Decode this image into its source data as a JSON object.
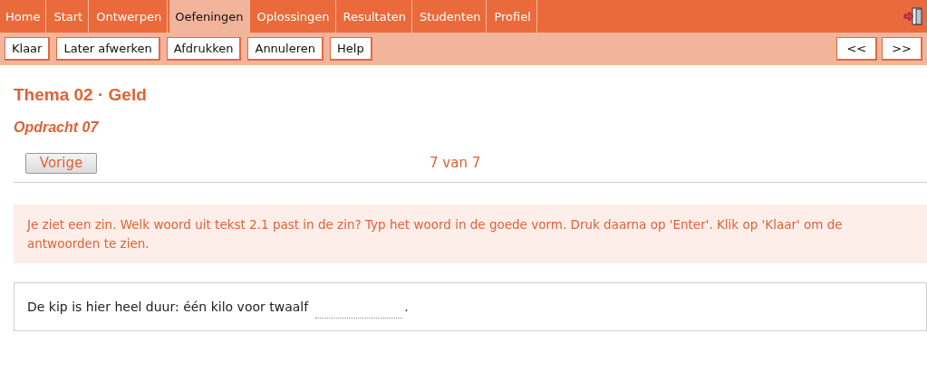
{
  "tabs": [
    {
      "label": "Home",
      "selected": false
    },
    {
      "label": "Start",
      "selected": false
    },
    {
      "label": "Ontwerpen",
      "selected": false
    },
    {
      "label": "Oefeningen",
      "selected": true
    },
    {
      "label": "Oplossingen",
      "selected": false
    },
    {
      "label": "Resultaten",
      "selected": false
    },
    {
      "label": "Studenten",
      "selected": false
    },
    {
      "label": "Profiel",
      "selected": false
    }
  ],
  "toolbar": [
    "Klaar",
    "Later afwerken",
    "Afdrukken",
    "Annuleren",
    "Help"
  ],
  "pager_buttons": [
    "<<",
    ">>"
  ],
  "title": "Thema 02 · Geld",
  "subtitle": "Opdracht 07",
  "previous_button": "Vorige",
  "position": "7 van 7",
  "instruction": "Je ziet een zin. Welk woord uit tekst 2.1 past in de zin? Typ het woord in de goede vorm. Druk daarna op 'Enter'. Klik op 'Klaar' om de antwoorden te zien.",
  "exercise": {
    "before": "De kip is hier heel duur: één kilo voor twaalf",
    "after": "."
  }
}
